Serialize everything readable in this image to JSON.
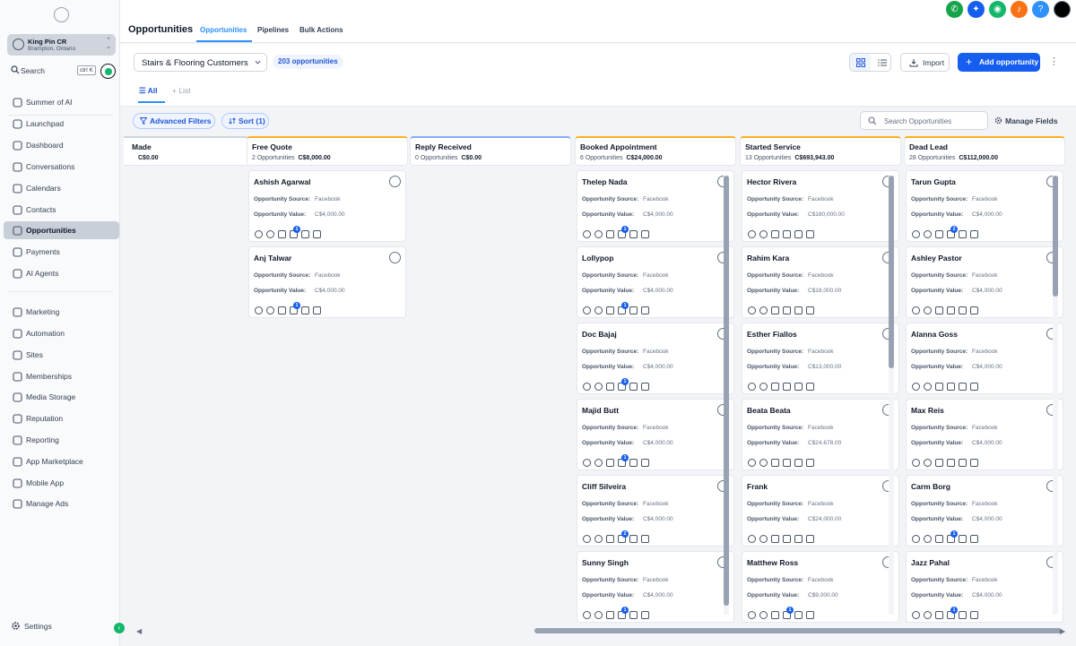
{
  "sidebar": {
    "location": {
      "name": "King Pin CR",
      "sub": "Brampton, Ontario"
    },
    "search": {
      "label": "Search",
      "shortcut": "ctrl K"
    },
    "items": [
      {
        "label": "Summer of AI",
        "icon": "sparkle-icon"
      },
      {
        "label": "Launchpad",
        "icon": "rocket-icon"
      },
      {
        "label": "Dashboard",
        "icon": "dashboard-icon"
      },
      {
        "label": "Conversations",
        "icon": "chat-icon"
      },
      {
        "label": "Calendars",
        "icon": "calendar-icon"
      },
      {
        "label": "Contacts",
        "icon": "contacts-icon"
      },
      {
        "label": "Opportunities",
        "icon": "opportunities-icon",
        "active": true
      },
      {
        "label": "Payments",
        "icon": "payments-icon"
      },
      {
        "label": "AI Agents",
        "icon": "ai-agents-icon"
      },
      {
        "label": "Marketing",
        "icon": "send-icon"
      },
      {
        "label": "Automation",
        "icon": "automation-icon"
      },
      {
        "label": "Sites",
        "icon": "sites-icon"
      },
      {
        "label": "Memberships",
        "icon": "membership-icon"
      },
      {
        "label": "Media Storage",
        "icon": "image-icon"
      },
      {
        "label": "Reputation",
        "icon": "star-icon"
      },
      {
        "label": "Reporting",
        "icon": "chart-icon"
      },
      {
        "label": "App Marketplace",
        "icon": "grid-icon"
      },
      {
        "label": "Mobile App",
        "icon": "phone-icon"
      },
      {
        "label": "Manage Ads",
        "icon": "facebook-icon"
      }
    ],
    "settings": "Settings"
  },
  "header": {
    "title": "Opportunities",
    "tabs": [
      "Opportunities",
      "Pipelines",
      "Bulk Actions"
    ]
  },
  "toolbar": {
    "pipeline": "Stairs & Flooring Customers",
    "count": "203 opportunities",
    "import": "Import",
    "add": "Add opportunity",
    "view_all": "All",
    "view_list": "+ List",
    "advanced_filters": "Advanced Filters",
    "sort": "Sort (1)",
    "search_placeholder": "Search Opportunities",
    "manage_fields": "Manage Fields"
  },
  "colors": {
    "accent": "#155eef",
    "active_tab": "#2e90fa"
  },
  "board": {
    "labels": {
      "source": "Opportunity Source:",
      "value": "Opportunity Value:"
    },
    "columns": [
      {
        "name": "Made",
        "meta": "",
        "total": "C$0.00",
        "accent": "#d0d5dd",
        "cards": []
      },
      {
        "name": "Free Quote",
        "meta": "2 Opportunities",
        "total": "C$8,000.00",
        "accent": "#fdb022",
        "cards": [
          {
            "name": "Ashish Agarwal",
            "source": "Facebook",
            "value": "C$4,000.00",
            "badge": "1"
          },
          {
            "name": "Anj Talwar",
            "source": "Facebook",
            "value": "C$4,000.00",
            "badge": "1"
          }
        ]
      },
      {
        "name": "Reply Received",
        "meta": "0 Opportunities",
        "total": "C$0.00",
        "accent": "#84adff",
        "cards": []
      },
      {
        "name": "Booked Appointment",
        "meta": "6 Opportunities",
        "total": "C$24,000.00",
        "accent": "#fdb022",
        "cards": [
          {
            "name": "Thelep Nada",
            "source": "Facebook",
            "value": "C$4,000.00",
            "badge": "1"
          },
          {
            "name": "Lollypop",
            "source": "Facebook",
            "value": "C$4,000.00",
            "badge": "1"
          },
          {
            "name": "Doc Bajaj",
            "source": "Facebook",
            "value": "C$4,000.00",
            "badge": "1"
          },
          {
            "name": "Majid Butt",
            "source": "Facebook",
            "value": "C$4,000.00",
            "badge": "1"
          },
          {
            "name": "Cliff Silveira",
            "source": "Facebook",
            "value": "C$4,000.00",
            "badge": "2"
          },
          {
            "name": "Sunny Singh",
            "source": "Facebook",
            "value": "C$4,000.00",
            "badge": "1"
          }
        ]
      },
      {
        "name": "Started Service",
        "meta": "13 Opportunities",
        "total": "C$693,943.00",
        "accent": "#fdb022",
        "cards": [
          {
            "name": "Hector Rivera",
            "source": "Facebook",
            "value": "C$180,000.00",
            "badge": ""
          },
          {
            "name": "Rahim Kara",
            "source": "Facebook",
            "value": "C$18,000.00",
            "badge": ""
          },
          {
            "name": "Esther Fiallos",
            "source": "Facebook",
            "value": "C$13,000.00",
            "badge": ""
          },
          {
            "name": "Beata Beata",
            "source": "Facebook",
            "value": "C$24,678.00",
            "badge": ""
          },
          {
            "name": "Frank",
            "source": "Facebook",
            "value": "C$24,000.00",
            "badge": ""
          },
          {
            "name": "Matthew Ross",
            "source": "Facebook",
            "value": "C$9,000.00",
            "badge": "1"
          }
        ]
      },
      {
        "name": "Dead Lead",
        "meta": "28 Opportunities",
        "total": "C$112,000.00",
        "accent": "#fdb022",
        "cards": [
          {
            "name": "Tarun Gupta",
            "source": "Facebook",
            "value": "C$4,000.00",
            "badge": "2"
          },
          {
            "name": "Ashley Pastor",
            "source": "Facebook",
            "value": "C$4,000.00",
            "badge": ""
          },
          {
            "name": "Alanna Goss",
            "source": "Facebook",
            "value": "C$4,000.00",
            "badge": ""
          },
          {
            "name": "Max Reis",
            "source": "Facebook",
            "value": "C$4,000.00",
            "badge": ""
          },
          {
            "name": "Carm Borg",
            "source": "Facebook",
            "value": "C$4,000.00",
            "badge": "1"
          },
          {
            "name": "Jazz Pahal",
            "source": "Facebook",
            "value": "C$4,000.00",
            "badge": "1"
          }
        ]
      }
    ]
  }
}
